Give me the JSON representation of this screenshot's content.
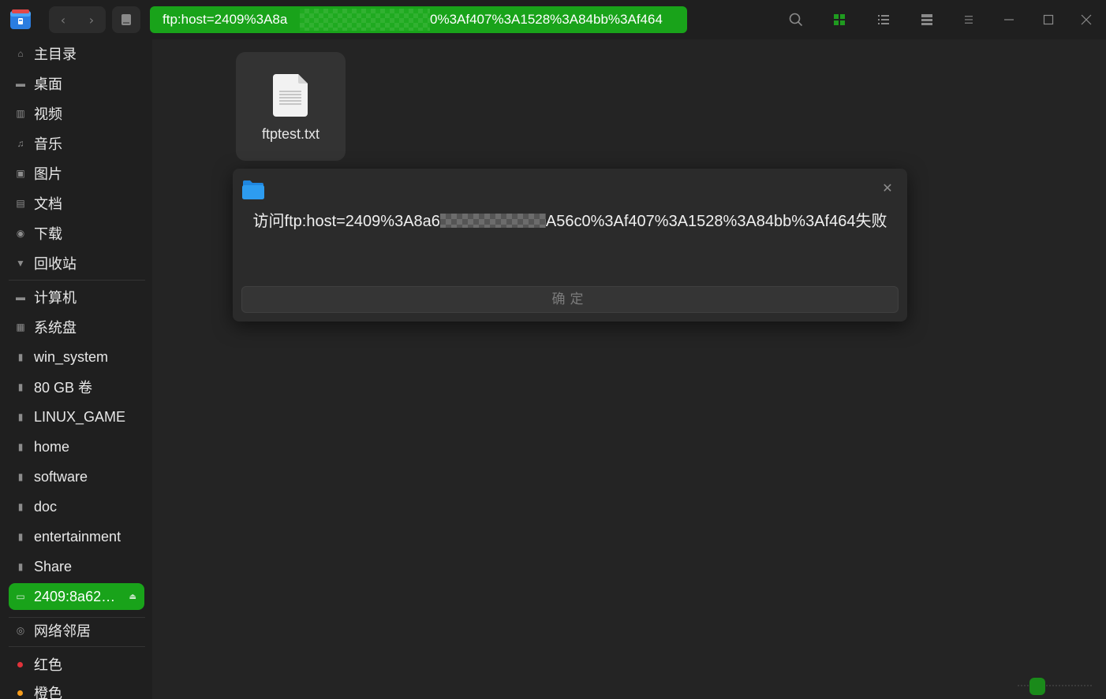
{
  "titlebar": {
    "address": "ftp:host=2409%3A8a6…0%3Af407%3A1528%3A84bb%3Af464",
    "address_prefix": "ftp:host=2409%3A8a",
    "address_suffix": "0%3Af407%3A1528%3A84bb%3Af464",
    "icons": [
      "search-icon",
      "icon-view-icon",
      "list-view-icon",
      "detail-view-icon",
      "menu-icon",
      "minimize-icon",
      "maximize-icon",
      "close-icon"
    ]
  },
  "sidebar": {
    "items": [
      {
        "label": "主目录",
        "icon": "home-icon"
      },
      {
        "label": "桌面",
        "icon": "desktop-icon"
      },
      {
        "label": "视频",
        "icon": "video-icon"
      },
      {
        "label": "音乐",
        "icon": "music-icon"
      },
      {
        "label": "图片",
        "icon": "picture-icon"
      },
      {
        "label": "文档",
        "icon": "document-icon"
      },
      {
        "label": "下载",
        "icon": "download-icon"
      },
      {
        "label": "回收站",
        "icon": "trash-icon"
      },
      {
        "label": "计算机",
        "icon": "computer-icon"
      },
      {
        "label": "系统盘",
        "icon": "disk-icon"
      },
      {
        "label": "win_system",
        "icon": "disk-icon"
      },
      {
        "label": "80 GB 卷",
        "icon": "disk-icon"
      },
      {
        "label": "LINUX_GAME",
        "icon": "disk-icon"
      },
      {
        "label": "home",
        "icon": "disk-icon"
      },
      {
        "label": "software",
        "icon": "disk-icon"
      },
      {
        "label": "doc",
        "icon": "disk-icon"
      },
      {
        "label": "entertainment",
        "icon": "disk-icon"
      },
      {
        "label": "Share",
        "icon": "disk-icon"
      },
      {
        "label": "2409:8a62…",
        "icon": "network-folder-icon",
        "active": true
      },
      {
        "label": "网络邻居",
        "icon": "network-icon"
      },
      {
        "label": "红色",
        "icon": "tag-dot",
        "color": "#e0323a"
      },
      {
        "label": "橙色",
        "icon": "tag-dot",
        "color": "#f59b1b"
      }
    ]
  },
  "content": {
    "files": [
      {
        "name": "ftptest.txt",
        "icon": "text-file-icon"
      }
    ]
  },
  "dialog": {
    "message_prefix": "访问ftp:host=2409%3A8a6",
    "message_suffix": "A56c0%3Af407%3A1528%3A84bb%3Af464失败",
    "ok_label": "确定"
  },
  "colors": {
    "accent": "#19a31a",
    "background": "#242424",
    "sidebar": "#1f1f1f",
    "dialog": "#2b2b2b"
  }
}
